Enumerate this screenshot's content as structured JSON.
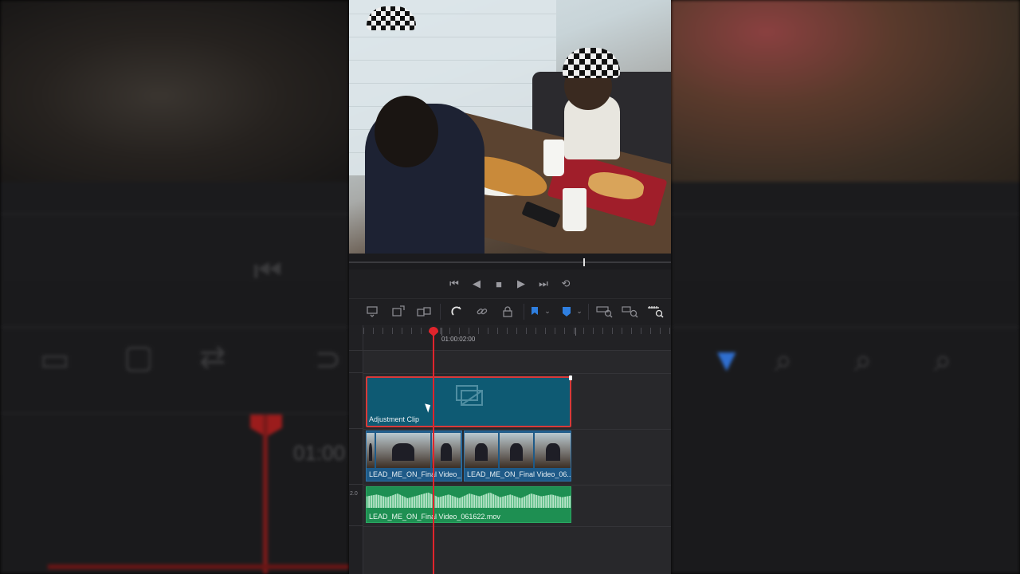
{
  "transport": {
    "prev_icon": "skip-to-start-icon",
    "reverse_icon": "play-reverse-icon",
    "stop_icon": "stop-icon",
    "play_icon": "play-icon",
    "next_icon": "skip-to-end-icon",
    "loop_icon": "loop-icon"
  },
  "toolbar": {
    "icons": [
      "insert-clip-icon",
      "overwrite-clip-icon",
      "replace-clip-icon",
      "snapping-icon",
      "link-icon",
      "lock-icon",
      "flag-icon",
      "marker-icon",
      "zoom-full-icon",
      "zoom-detail-icon",
      "zoom-custom-icon"
    ],
    "flag_color": "#2f7fe0",
    "marker_color": "#2f7fe0"
  },
  "timeline": {
    "timecode": "01:00:02:00",
    "audio_level": "2.0",
    "playhead_color": "#e0242c"
  },
  "clips": {
    "adjustment": {
      "label": "Adjustment Clip",
      "color": "#0e5a73"
    },
    "video1": {
      "label": "LEAD_ME_ON_Final Video_...",
      "color": "#1e5a88"
    },
    "video2": {
      "label": "LEAD_ME_ON_Final Video_06...",
      "color": "#1e5a88"
    },
    "audio": {
      "label": "LEAD_ME_ON_Final Video_061622.mov",
      "color": "#1e8f52"
    }
  },
  "background": {
    "timecode": "01:00"
  }
}
